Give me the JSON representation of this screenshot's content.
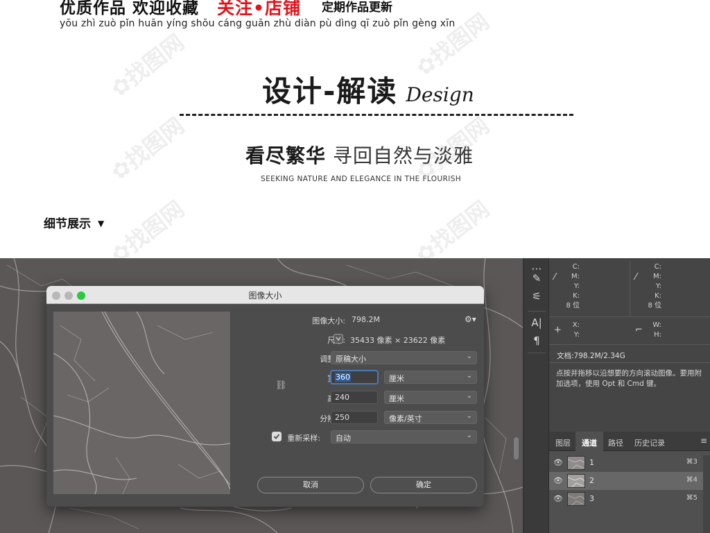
{
  "banner": {
    "slogan": "优质作品 欢迎收藏",
    "highlight": "关注•店铺",
    "update": "定期作品更新",
    "pinyin": "yōu zhì zuò pǐn huān yíng shōu cáng guān zhù diàn pù dìng qī zuò pǐn gèng xīn"
  },
  "design": {
    "title_cn": "设计-解读",
    "title_en": "Design",
    "motto_bold": "看尽繁华",
    "motto_light": "寻回自然与淡雅",
    "motto_en": "SEEKING NATURE AND ELEGANCE IN THE FLOURISH"
  },
  "details": {
    "label": "细节展示",
    "arrow": "▼"
  },
  "dialog": {
    "title": "图像大小",
    "image_size_label": "图像大小:",
    "image_size_value": "798.2M",
    "dimensions_label": "尺寸:",
    "dimensions_value": "35433 像素 × 23622 像素",
    "fit_label": "调整为:",
    "fit_value": "原稿大小",
    "width_label": "宽度:",
    "width_value": "360",
    "width_unit": "厘米",
    "height_label": "高度:",
    "height_value": "240",
    "height_unit": "厘米",
    "resolution_label": "分辨率:",
    "resolution_value": "250",
    "resolution_unit": "像素/英寸",
    "resample_label": "重新采样:",
    "resample_checked": true,
    "resample_value": "自动",
    "cancel": "取消",
    "ok": "确定"
  },
  "info_panel": {
    "left_cmyk": [
      "C:",
      "M:",
      "Y:",
      "K:",
      "8 位"
    ],
    "right_cmyk": [
      "C:",
      "M:",
      "Y:",
      "K:",
      "8 位"
    ],
    "xy": [
      "X:",
      "Y:"
    ],
    "wh": [
      "W:",
      "H:"
    ],
    "doc": "文档:798.2M/2.34G",
    "hint": "点按并拖移以沿想要的方向滚动图像。要用附加选项，使用 Opt 和 Cmd 键。"
  },
  "channels_panel": {
    "tabs": [
      "图层",
      "通道",
      "路径",
      "历史记录"
    ],
    "active_tab": "通道",
    "channels": [
      {
        "name": "1",
        "shortcut": "⌘3"
      },
      {
        "name": "2",
        "shortcut": "⌘4"
      },
      {
        "name": "3",
        "shortcut": "⌘5"
      }
    ]
  },
  "colors": {
    "accent_red": "#e3131b",
    "dialog_bg": "#4c4c4c",
    "panel_bg": "#454545",
    "green_light": "#2ac940"
  }
}
